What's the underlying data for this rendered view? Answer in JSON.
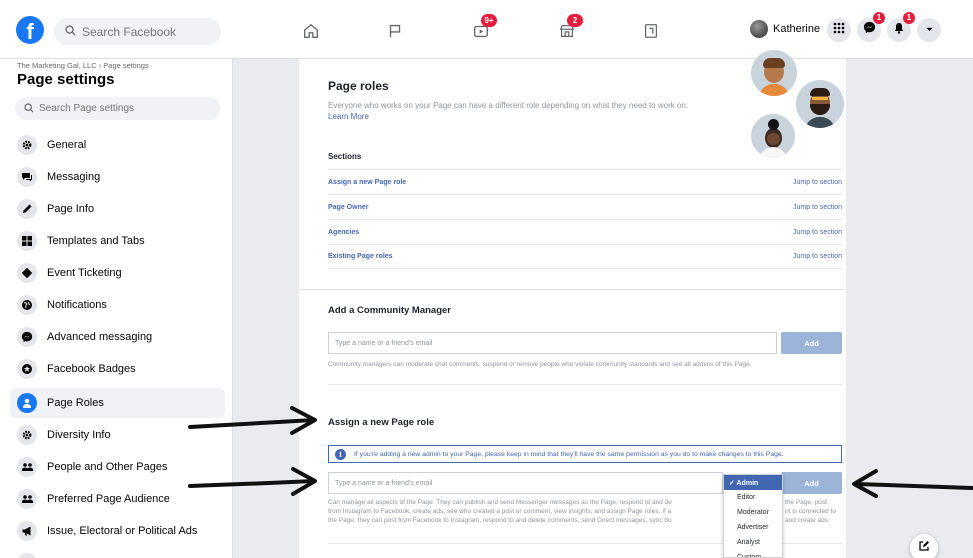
{
  "topbar": {
    "logo": "f",
    "search_placeholder": "Search Facebook",
    "watch_badge": "9+",
    "marketplace_badge": "2",
    "user_name": "Katherine",
    "messenger_badge": "1",
    "notifications_badge": "1"
  },
  "sidebar": {
    "breadcrumb": "The Marketing Gal, LLC › Page settings",
    "title": "Page settings",
    "search_placeholder": "Search Page settings",
    "items": [
      {
        "label": "General",
        "icon": "gear-icon"
      },
      {
        "label": "Messaging",
        "icon": "chat-icon"
      },
      {
        "label": "Page Info",
        "icon": "pencil-icon"
      },
      {
        "label": "Templates and Tabs",
        "icon": "grid-icon"
      },
      {
        "label": "Event Ticketing",
        "icon": "ticket-icon"
      },
      {
        "label": "Notifications",
        "icon": "globe-icon"
      },
      {
        "label": "Advanced messaging",
        "icon": "messenger-icon"
      },
      {
        "label": "Facebook Badges",
        "icon": "badge-icon"
      },
      {
        "label": "Page Roles",
        "icon": "person-icon",
        "active": true
      },
      {
        "label": "Diversity Info",
        "icon": "gear-icon"
      },
      {
        "label": "People and Other Pages",
        "icon": "people-icon"
      },
      {
        "label": "Preferred Page Audience",
        "icon": "people-icon"
      },
      {
        "label": "Issue, Electoral or Political Ads",
        "icon": "megaphone-icon"
      }
    ]
  },
  "main": {
    "roles_title": "Page roles",
    "roles_desc": "Everyone who works on your Page can have a different role depending on what they need to work on.",
    "learn_more": "Learn More",
    "sections_label": "Sections",
    "sections": [
      {
        "name": "Assign a new Page role",
        "jump": "Jump to section"
      },
      {
        "name": "Page Owner",
        "jump": "Jump to section"
      },
      {
        "name": "Agencies",
        "jump": "Jump to section"
      },
      {
        "name": "Existing Page roles",
        "jump": "Jump to section"
      }
    ],
    "community": {
      "title": "Add a Community Manager",
      "placeholder": "Type a name or a friend's email",
      "add": "Add",
      "help": "Community managers can moderate chat comments, suspend or remove people who violate community standards and see all admins of this Page."
    },
    "assign": {
      "title": "Assign a new Page role",
      "info": "If you're adding a new admin to your Page, please keep in mind that they'll have the same permission as you do to make changes to this Page.",
      "placeholder": "Type a name or a friend's email",
      "add": "Add",
      "help_line1": "Can manage all aspects of the Page. They can publish and send Messenger messages as the Page, respond to and de",
      "help_line1_end": "the Page, post",
      "help_line2": "from Instagram to Facebook, create ads, see who created a post or comment, view insights, and assign Page roles. If a",
      "help_line2_end": "nt is connected to",
      "help_line3": "the Page, they can post from Facebook to Instagram, respond to and delete comments, send Direct messages, sync bu",
      "help_line3_end": "and create ads."
    },
    "role_options": [
      "✓ Admin",
      "Editor",
      "Moderator",
      "Advertiser",
      "Analyst",
      "Custom"
    ]
  },
  "colors": {
    "brand": "#1877f2",
    "link": "#4267b2",
    "badge": "#e41e3f",
    "button_disabled": "#9cb4d8"
  }
}
